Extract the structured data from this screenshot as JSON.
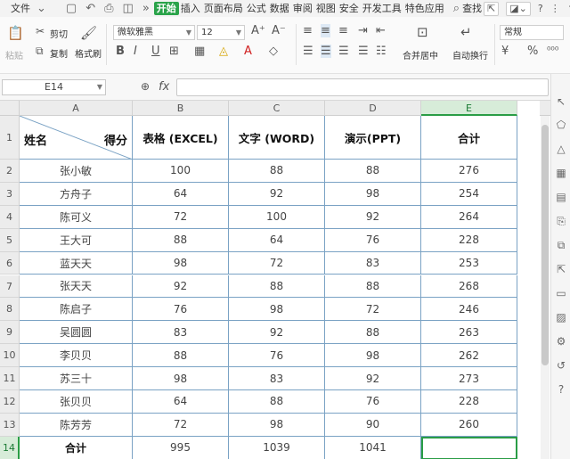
{
  "menubar": {
    "file": "文件",
    "tabs": [
      "开始",
      "插入",
      "页面布局",
      "公式",
      "数据",
      "审阅",
      "视图",
      "安全",
      "开发工具",
      "特色应用"
    ],
    "search": "查找"
  },
  "ribbon": {
    "cut": "剪切",
    "paste": "粘贴",
    "copy": "复制",
    "format_painter": "格式刷",
    "font_name": "微软雅黑",
    "font_size": "12",
    "merge_center": "合并居中",
    "wrap_text": "自动换行",
    "number_format": "常规"
  },
  "formula_bar": {
    "name_box": "E14",
    "fx": "fx",
    "formula": ""
  },
  "columns": [
    "A",
    "B",
    "C",
    "D",
    "E"
  ],
  "rows": [
    "1",
    "2",
    "3",
    "4",
    "5",
    "6",
    "7",
    "8",
    "9",
    "10",
    "11",
    "12",
    "13",
    "14"
  ],
  "table": {
    "header_name": "姓名",
    "header_score": "得分",
    "headers": [
      "表格 (EXCEL)",
      "文字 (WORD)",
      "演示(PPT)",
      "合计"
    ],
    "records": [
      [
        "张小敏",
        "100",
        "88",
        "88",
        "276"
      ],
      [
        "方舟子",
        "64",
        "92",
        "98",
        "254"
      ],
      [
        "陈可义",
        "72",
        "100",
        "92",
        "264"
      ],
      [
        "王大可",
        "88",
        "64",
        "76",
        "228"
      ],
      [
        "蓝天天",
        "98",
        "72",
        "83",
        "253"
      ],
      [
        "张天天",
        "92",
        "88",
        "88",
        "268"
      ],
      [
        "陈启子",
        "76",
        "98",
        "72",
        "246"
      ],
      [
        "吴圆圆",
        "83",
        "92",
        "88",
        "263"
      ],
      [
        "李贝贝",
        "88",
        "76",
        "98",
        "262"
      ],
      [
        "苏三十",
        "98",
        "83",
        "92",
        "273"
      ],
      [
        "张贝贝",
        "64",
        "88",
        "76",
        "228"
      ],
      [
        "陈芳芳",
        "72",
        "98",
        "90",
        "260"
      ]
    ],
    "total_row": [
      "合计",
      "995",
      "1039",
      "1041",
      ""
    ]
  },
  "colors": {
    "accent": "#2a9d46",
    "grid_border": "#7aa2c4"
  }
}
